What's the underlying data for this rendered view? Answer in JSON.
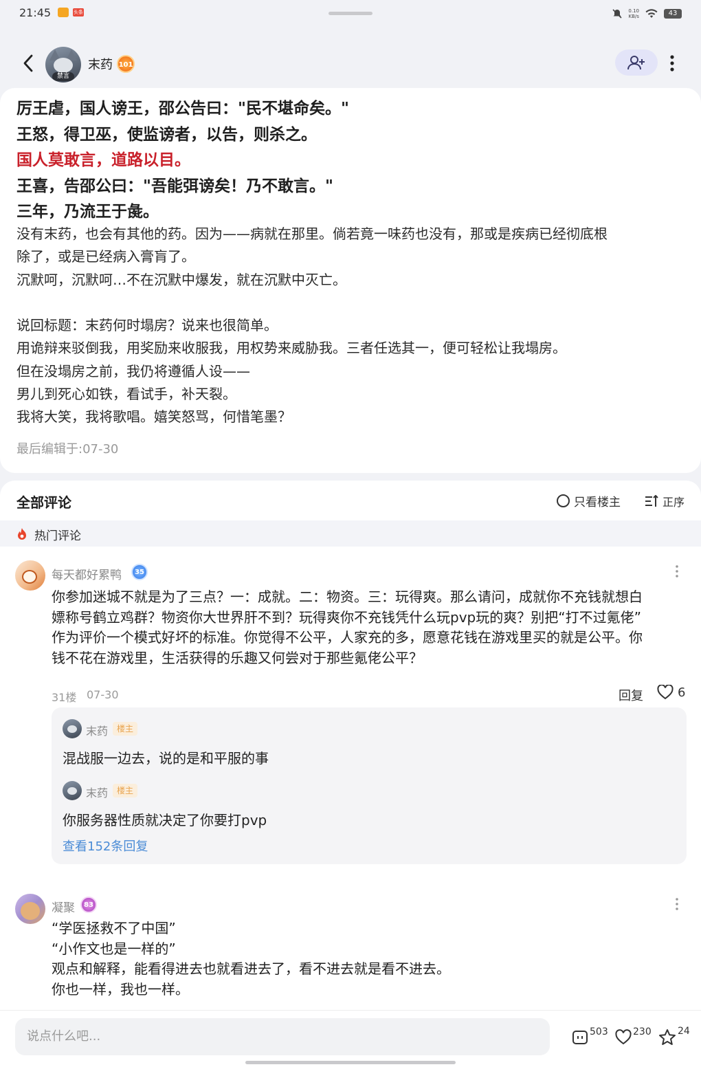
{
  "status_bar": {
    "time": "21:45",
    "app2_label": "头条",
    "net_speed_value": "0.10",
    "net_speed_unit": "KB/s",
    "battery": "43"
  },
  "header": {
    "author_name": "末药",
    "author_level": "101",
    "ban_tag": "禁言"
  },
  "post": {
    "poem_lines": [
      {
        "text": "厉王虐，国人谤王，邵公告曰：\"民不堪命矣。\"",
        "highlight": false
      },
      {
        "text": "王怒，得卫巫，使监谤者，以告，则杀之。",
        "highlight": false
      },
      {
        "text": "国人莫敢言，道路以目。",
        "highlight": true
      },
      {
        "text": "王喜，告邵公曰：\"吾能弭谤矣！乃不敢言。\"",
        "highlight": false
      },
      {
        "text": "三年，乃流王于彘。",
        "highlight": false
      }
    ],
    "body_lines": [
      "没有末药，也会有其他的药。因为——病就在那里。倘若竟一味药也没有，那或是疾病已经彻底根",
      "除了，或是已经病入膏肓了。",
      "沉默呵，沉默呵…不在沉默中爆发，就在沉默中灭亡。",
      "",
      "说回标题：末药何时塌房？说来也很简单。",
      "用诡辩来驳倒我，用奖励来收服我，用权势来威胁我。三者任选其一，便可轻松让我塌房。",
      "但在没塌房之前，我仍将遵循人设——",
      "男儿到死心如铁，看试手，补天裂。",
      "我将大笑，我将歌唱。嬉笑怒骂，何惜笔墨？"
    ],
    "last_edited": "最后编辑于:07-30"
  },
  "comments_section": {
    "title": "全部评论",
    "only_op_label": "只看楼主",
    "sort_label": "正序",
    "hot_label": "热门评论"
  },
  "comments": [
    {
      "user": "每天都好累鸭",
      "level": "35",
      "lines": [
        "你参加迷城不就是为了三点？一：成就。二：物资。三：玩得爽。那么请问，成就你不充钱就想白",
        "嫖称号鹤立鸡群？物资你大世界肝不到？玩得爽你不充钱凭什么玩pvp玩的爽？别把“打不过氪佬”",
        "作为评价一个模式好坏的标准。你觉得不公平，人家充的多，愿意花钱在游戏里买的就是公平。你",
        "钱不花在游戏里，生活获得的乐趣又何尝对于那些氪佬公平？"
      ],
      "floor": "31楼",
      "date": "07-30",
      "reply_label": "回复",
      "likes": "6",
      "replies": [
        {
          "user": "末药",
          "tag": "楼主",
          "text": "混战服一边去，说的是和平服的事"
        },
        {
          "user": "末药",
          "tag": "楼主",
          "text": "你服务器性质就决定了你要打pvp"
        }
      ],
      "view_replies": "查看152条回复"
    },
    {
      "user": "凝聚",
      "level": "83",
      "lines": [
        "“学医拯救不了中国”",
        "“小作文也是一样的”",
        "观点和解释，能看得进去也就看进去了，看不进去就是看不进去。",
        "你也一样，我也一样。"
      ]
    }
  ],
  "bottom_bar": {
    "input_placeholder": "说点什么吧...",
    "comment_count": "503",
    "like_count": "230",
    "star_count": "24"
  },
  "colors": {
    "highlight_red": "#c9212b",
    "link_blue": "#4a8bd6",
    "follow_bg": "#e3e4f8"
  }
}
